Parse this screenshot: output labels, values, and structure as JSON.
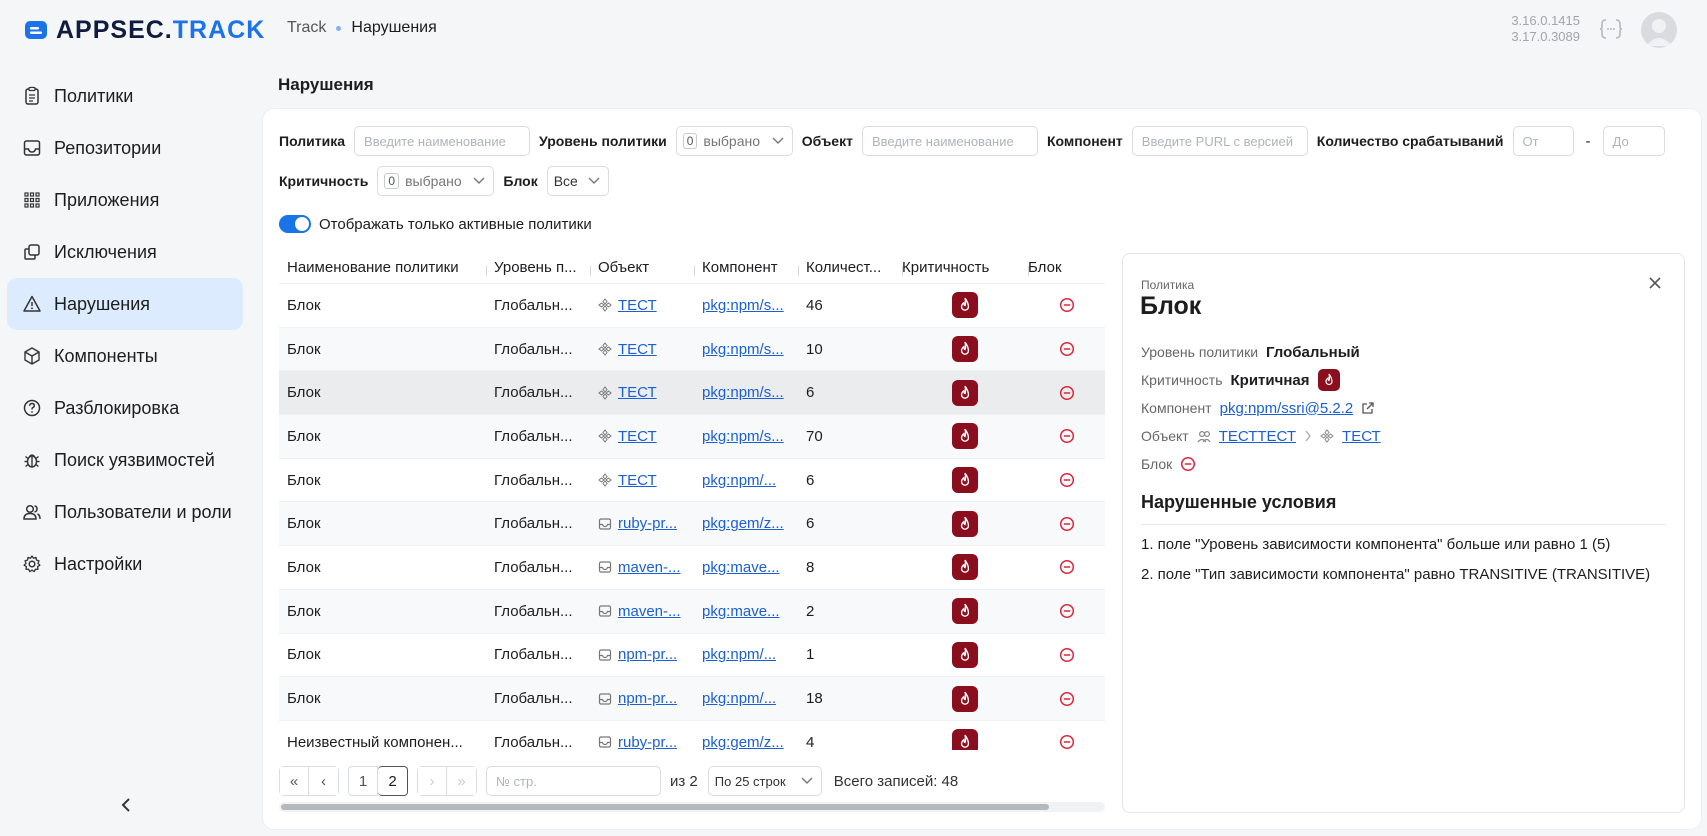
{
  "app": {
    "logo_part1": "APPSEC.",
    "logo_part2": "TRACK",
    "brand_color": "#1a73e8"
  },
  "header": {
    "breadcrumb": [
      "Track",
      "Нарушения"
    ],
    "version1": "3.16.0.1415",
    "version2": "3.17.0.3089"
  },
  "sidebar": {
    "items": [
      {
        "label": "Политики",
        "icon": "clipboard-icon"
      },
      {
        "label": "Репозитории",
        "icon": "inbox-icon"
      },
      {
        "label": "Приложения",
        "icon": "grid-icon"
      },
      {
        "label": "Исключения",
        "icon": "layers-icon"
      },
      {
        "label": "Нарушения",
        "icon": "warning-icon",
        "active": true
      },
      {
        "label": "Компоненты",
        "icon": "package-icon"
      },
      {
        "label": "Разблокировка",
        "icon": "help-circle-icon"
      },
      {
        "label": "Поиск уязвимостей",
        "icon": "bug-icon"
      },
      {
        "label": "Пользователи и роли",
        "icon": "users-icon"
      },
      {
        "label": "Настройки",
        "icon": "gear-icon"
      }
    ]
  },
  "page": {
    "title": "Нарушения"
  },
  "filters": {
    "policy_label": "Политика",
    "policy_placeholder": "Введите наименование",
    "level_label": "Уровень политики",
    "level_count": "0",
    "level_value": "выбрано",
    "object_label": "Объект",
    "object_placeholder": "Введите наименование",
    "component_label": "Компонент",
    "component_placeholder": "Введите PURL с версией",
    "count_label": "Количество срабатываний",
    "from_placeholder": "От",
    "dash": "-",
    "to_placeholder": "До",
    "criticality_label": "Критичность",
    "crit_count": "0",
    "crit_value": "выбрано",
    "block_label": "Блок",
    "block_value": "Все",
    "toggle_label": "Отображать только активные политики"
  },
  "table": {
    "headers": [
      "Наименование политики",
      "Уровень п...",
      "Объект",
      "Компонент",
      "Количест...",
      "Критичность",
      "Блок"
    ],
    "rows": [
      {
        "name": "Блок",
        "level": "Глобальн...",
        "object": "ТЕСТ",
        "obj_icon": "app",
        "component": "pkg:npm/s...",
        "count": "46"
      },
      {
        "name": "Блок",
        "level": "Глобальн...",
        "object": "ТЕСТ",
        "obj_icon": "app",
        "component": "pkg:npm/s...",
        "count": "10"
      },
      {
        "name": "Блок",
        "level": "Глобальн...",
        "object": "ТЕСТ",
        "obj_icon": "app",
        "component": "pkg:npm/s...",
        "count": "6"
      },
      {
        "name": "Блок",
        "level": "Глобальн...",
        "object": "ТЕСТ",
        "obj_icon": "app",
        "component": "pkg:npm/s...",
        "count": "70"
      },
      {
        "name": "Блок",
        "level": "Глобальн...",
        "object": "ТЕСТ",
        "obj_icon": "app",
        "component": "pkg:npm/...",
        "count": "6"
      },
      {
        "name": "Блок",
        "level": "Глобальн...",
        "object": "ruby-pr...",
        "obj_icon": "repo",
        "component": "pkg:gem/z...",
        "count": "6"
      },
      {
        "name": "Блок",
        "level": "Глобальн...",
        "object": "maven-...",
        "obj_icon": "repo",
        "component": "pkg:mave...",
        "count": "8"
      },
      {
        "name": "Блок",
        "level": "Глобальн...",
        "object": "maven-...",
        "obj_icon": "repo",
        "component": "pkg:mave...",
        "count": "2"
      },
      {
        "name": "Блок",
        "level": "Глобальн...",
        "object": "npm-pr...",
        "obj_icon": "repo",
        "component": "pkg:npm/...",
        "count": "1"
      },
      {
        "name": "Блок",
        "level": "Глобальн...",
        "object": "npm-pr...",
        "obj_icon": "repo",
        "component": "pkg:npm/...",
        "count": "18"
      },
      {
        "name": "Неизвестный компонен...",
        "level": "Глобальн...",
        "object": "ruby-pr...",
        "obj_icon": "repo",
        "component": "pkg:gem/z...",
        "count": "4"
      }
    ],
    "crit_color": "#8b0e1f",
    "block_color": "#d9283a"
  },
  "pager": {
    "pages": [
      "1",
      "2"
    ],
    "page_placeholder": "№ стр.",
    "of_text": "из 2",
    "per_page": "По 25 строк",
    "total": "Всего записей: 48"
  },
  "detail": {
    "small_label": "Политика",
    "title": "Блок",
    "level_key": "Уровень политики",
    "level_val": "Глобальный",
    "crit_key": "Критичность",
    "crit_val": "Критичная",
    "component_key": "Компонент",
    "component_val": "pkg:npm/ssri@5.2.2",
    "object_key": "Объект",
    "object_group": "ТЕСТТЕСТ",
    "object_app": "ТЕСТ",
    "block_key": "Блок",
    "conditions_title": "Нарушенные условия",
    "conditions": [
      "1. поле \"Уровень зависимости компонента\" больше или равно 1 (5)",
      "2. поле \"Тип зависимости компонента\" равно TRANSITIVE (TRANSITIVE)"
    ]
  }
}
